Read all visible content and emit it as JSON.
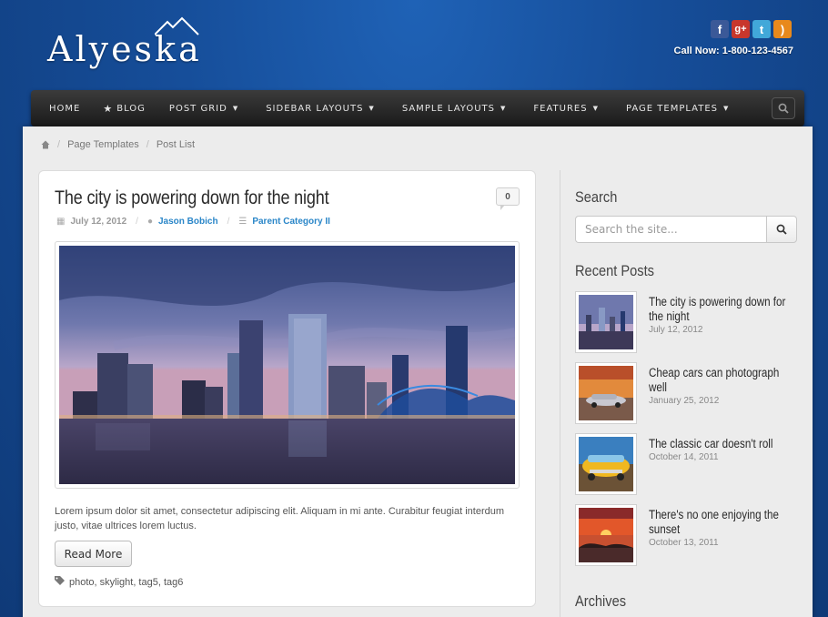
{
  "header": {
    "logo_text": "Alyeska",
    "call_now": "Call Now: 1-800-123-4567",
    "social": [
      {
        "icon": "facebook-icon",
        "glyph": "f"
      },
      {
        "icon": "google-plus-icon",
        "glyph": "g+"
      },
      {
        "icon": "twitter-icon",
        "glyph": "t"
      },
      {
        "icon": "rss-icon",
        "glyph": ")"
      }
    ]
  },
  "nav": {
    "items": [
      {
        "label": "Home",
        "caret": false,
        "star": false
      },
      {
        "label": "Blog",
        "caret": false,
        "star": true
      },
      {
        "label": "Post Grid",
        "caret": true,
        "star": false
      },
      {
        "label": "Sidebar Layouts",
        "caret": true,
        "star": false
      },
      {
        "label": "Sample Layouts",
        "caret": true,
        "star": false
      },
      {
        "label": "Features",
        "caret": true,
        "star": false
      },
      {
        "label": "Page Templates",
        "caret": true,
        "star": false
      }
    ]
  },
  "breadcrumb": {
    "items": [
      "Page Templates",
      "Post List"
    ]
  },
  "post": {
    "title": "The city is powering down for the night",
    "comments": "0",
    "date": "July 12, 2012",
    "author": "Jason Bobich",
    "category": "Parent Category II",
    "excerpt": "Lorem ipsum dolor sit amet, consectetur adipiscing elit. Aliquam in mi ante. Curabitur feugiat interdum justo, vitae ultrices lorem luctus.",
    "read_more": "Read More",
    "tags": "photo, skylight, tag5, tag6"
  },
  "sidebar": {
    "search_title": "Search",
    "search_placeholder": "Search the site...",
    "recent_title": "Recent Posts",
    "recent_posts": [
      {
        "title": "The city is powering down for the night",
        "date": "July 12, 2012"
      },
      {
        "title": "Cheap cars can photograph well",
        "date": "January 25, 2012"
      },
      {
        "title": "The classic car doesn't roll",
        "date": "October 14, 2011"
      },
      {
        "title": "There's no one enjoying the sunset",
        "date": "October 13, 2011"
      }
    ],
    "archives_title": "Archives"
  },
  "colors": {
    "background": "#164e9a",
    "navbar": "#1a1a1a",
    "link": "#2a86c8"
  }
}
